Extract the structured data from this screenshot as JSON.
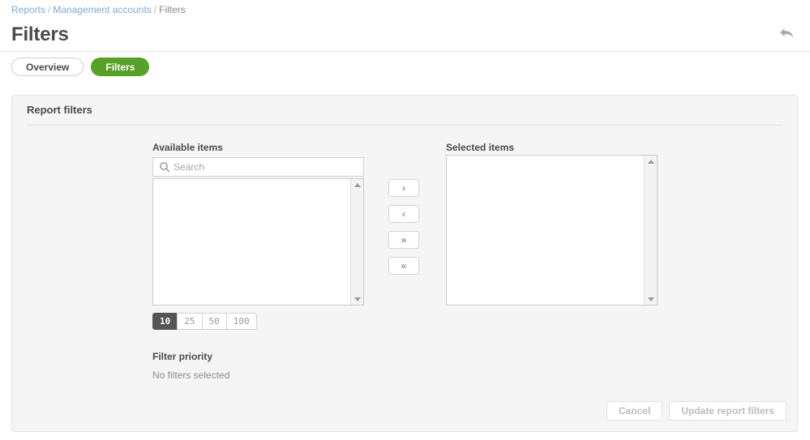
{
  "breadcrumb": {
    "items": [
      {
        "label": "Reports",
        "type": "link"
      },
      {
        "label": "Management accounts",
        "type": "link"
      },
      {
        "label": "Filters",
        "type": "current"
      }
    ],
    "separator": "/"
  },
  "header": {
    "title": "Filters",
    "back_icon": "back-arrow-icon"
  },
  "tabs": [
    {
      "label": "Overview",
      "active": false
    },
    {
      "label": "Filters",
      "active": true
    }
  ],
  "panel": {
    "title": "Report filters"
  },
  "available": {
    "label": "Available items",
    "search": {
      "icon": "search-icon",
      "value": "",
      "placeholder": "Search"
    },
    "items": []
  },
  "selected": {
    "label": "Selected items",
    "items": []
  },
  "transfer_buttons": [
    {
      "name": "move-right-button",
      "glyph": "›"
    },
    {
      "name": "move-left-button",
      "glyph": "‹"
    },
    {
      "name": "move-all-right-button",
      "glyph": "»"
    },
    {
      "name": "move-all-left-button",
      "glyph": "«"
    }
  ],
  "page_sizes": [
    {
      "label": "10",
      "active": true
    },
    {
      "label": "25",
      "active": false
    },
    {
      "label": "50",
      "active": false
    },
    {
      "label": "100",
      "active": false
    }
  ],
  "filter_priority": {
    "label": "Filter priority",
    "empty_text": "No filters selected"
  },
  "footer": {
    "cancel_label": "Cancel",
    "submit_label": "Update report filters"
  },
  "colors": {
    "accent_green": "#56a127",
    "link_blue": "#7fa9d4",
    "panel_bg": "#f5f5f5",
    "active_dark": "#555555"
  }
}
